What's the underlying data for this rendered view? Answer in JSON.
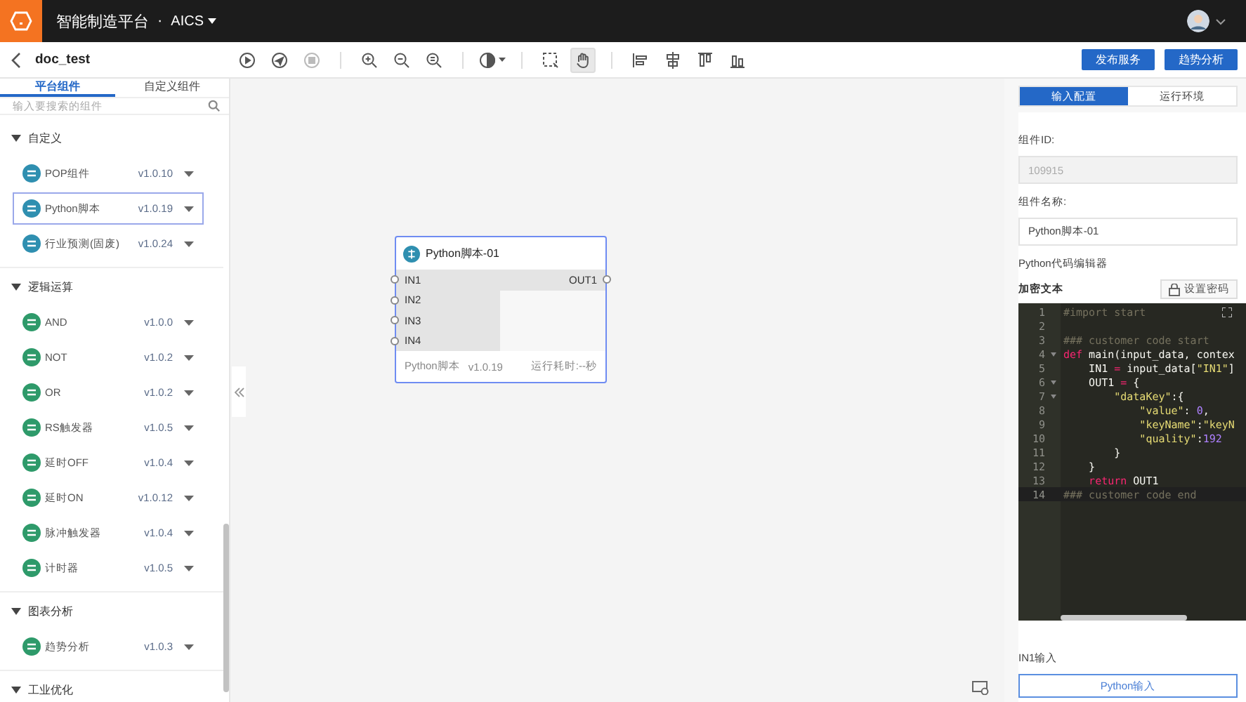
{
  "header": {
    "title": "智能制造平台",
    "separator": "·",
    "product": "AICS"
  },
  "toolbar": {
    "back_title": "doc_test",
    "tools": [
      {
        "kind": "play",
        "disabled": false,
        "selected": false
      },
      {
        "kind": "send",
        "disabled": false,
        "selected": false
      },
      {
        "kind": "stop",
        "disabled": true,
        "selected": false
      },
      {
        "kind": "zoom-in",
        "disabled": false,
        "selected": false
      },
      {
        "kind": "zoom-out",
        "disabled": false,
        "selected": false
      },
      {
        "kind": "zoom-fit",
        "disabled": false,
        "selected": false
      },
      {
        "kind": "theme",
        "disabled": false,
        "selected": false
      },
      {
        "kind": "select",
        "disabled": false,
        "selected": false
      },
      {
        "kind": "hand",
        "disabled": false,
        "selected": true
      },
      {
        "kind": "align-left",
        "disabled": false,
        "selected": false
      },
      {
        "kind": "align-center",
        "disabled": false,
        "selected": false
      },
      {
        "kind": "align-top",
        "disabled": false,
        "selected": false
      },
      {
        "kind": "align-bottom",
        "disabled": false,
        "selected": false
      }
    ],
    "buttons": [
      "发布服务",
      "趋势分析"
    ]
  },
  "sidebar": {
    "tabs": [
      {
        "label": "平台组件",
        "selected": true
      },
      {
        "label": "自定义组件",
        "selected": false
      }
    ],
    "search": {
      "placeholder": "输入要搜索的组件"
    },
    "sections": [
      {
        "title": "自定义",
        "expanded": true,
        "items": [
          {
            "name": "POP组件",
            "version": "v1.0.10",
            "color": "#2f8fb0",
            "selected": false
          },
          {
            "name": "Python脚本",
            "version": "v1.0.19",
            "color": "#2f8fb0",
            "selected": true
          },
          {
            "name": "行业预测(固废)",
            "version": "v1.0.24",
            "color": "#2f8fb0",
            "selected": false
          }
        ]
      },
      {
        "title": "逻辑运算",
        "expanded": true,
        "items": [
          {
            "name": "AND",
            "version": "v1.0.0",
            "color": "#2e9a6a",
            "selected": false
          },
          {
            "name": "NOT",
            "version": "v1.0.2",
            "color": "#2e9a6a",
            "selected": false
          },
          {
            "name": "OR",
            "version": "v1.0.2",
            "color": "#2e9a6a",
            "selected": false
          },
          {
            "name": "RS触发器",
            "version": "v1.0.5",
            "color": "#2e9a6a",
            "selected": false
          },
          {
            "name": "延时OFF",
            "version": "v1.0.4",
            "color": "#2e9a6a",
            "selected": false
          },
          {
            "name": "延时ON",
            "version": "v1.0.12",
            "color": "#2e9a6a",
            "selected": false
          },
          {
            "name": "脉冲触发器",
            "version": "v1.0.4",
            "color": "#2e9a6a",
            "selected": false
          },
          {
            "name": "计时器",
            "version": "v1.0.5",
            "color": "#2e9a6a",
            "selected": false
          }
        ]
      },
      {
        "title": "图表分析",
        "expanded": true,
        "items": [
          {
            "name": "趋势分析",
            "version": "v1.0.3",
            "color": "#2e9a6a",
            "selected": false
          }
        ]
      },
      {
        "title": "工业优化",
        "expanded": true
      }
    ]
  },
  "canvas": {
    "node": {
      "title": "Python脚本-01",
      "selected": true,
      "inputs": [
        "IN1",
        "IN2",
        "IN3",
        "IN4"
      ],
      "outputs": [
        "OUT1"
      ],
      "type": "Python脚本",
      "version": "v1.0.19",
      "runtime": "运行耗时:--秒"
    }
  },
  "panel": {
    "tabs": [
      {
        "label": "输入配置",
        "selected": true
      },
      {
        "label": "运行环境",
        "selected": false
      }
    ],
    "fields": [
      {
        "label": "组件ID:",
        "value": "109915",
        "disabled": true
      },
      {
        "label": "组件名称:",
        "value": "Python脚本-01",
        "disabled": false
      }
    ],
    "editor_label": "Python代码编辑器",
    "encrypt_label": "加密文本",
    "password_button": "设置密码",
    "code": [
      {
        "number": "1",
        "fold": false,
        "active": false,
        "tokens": [
          {
            "text": "#import start",
            "kind": "comment"
          }
        ]
      },
      {
        "number": "2",
        "fold": false,
        "active": false
      },
      {
        "number": "3",
        "fold": false,
        "active": false,
        "tokens": [
          {
            "text": "### customer code start",
            "kind": "comment"
          }
        ]
      },
      {
        "number": "4",
        "fold": true,
        "active": false,
        "tokens": [
          {
            "text": "def",
            "kind": "keyword"
          },
          {
            "text": " main(input_data, contex",
            "kind": "plain"
          }
        ]
      },
      {
        "number": "5",
        "fold": false,
        "active": false,
        "tokens": [
          {
            "text": "    IN1 ",
            "kind": "plain"
          },
          {
            "text": "=",
            "kind": "keyword"
          },
          {
            "text": " input_data[",
            "kind": "plain"
          },
          {
            "text": "\"IN1\"",
            "kind": "string"
          },
          {
            "text": "]",
            "kind": "plain"
          }
        ]
      },
      {
        "number": "6",
        "fold": true,
        "active": false,
        "tokens": [
          {
            "text": "    OUT1 ",
            "kind": "plain"
          },
          {
            "text": "=",
            "kind": "keyword"
          },
          {
            "text": " {",
            "kind": "plain"
          }
        ]
      },
      {
        "number": "7",
        "fold": true,
        "active": false,
        "tokens": [
          {
            "text": "        \"dataKey\"",
            "kind": "string"
          },
          {
            "text": ":{",
            "kind": "plain"
          }
        ]
      },
      {
        "number": "8",
        "fold": false,
        "active": false,
        "tokens": [
          {
            "text": "            \"value\"",
            "kind": "string"
          },
          {
            "text": ": ",
            "kind": "plain"
          },
          {
            "text": "0",
            "kind": "number"
          },
          {
            "text": ",",
            "kind": "plain"
          }
        ]
      },
      {
        "number": "9",
        "fold": false,
        "active": false,
        "tokens": [
          {
            "text": "            \"keyName\"",
            "kind": "string"
          },
          {
            "text": ":",
            "kind": "plain"
          },
          {
            "text": "\"keyN",
            "kind": "string"
          }
        ]
      },
      {
        "number": "10",
        "fold": false,
        "active": false,
        "tokens": [
          {
            "text": "            \"quality\"",
            "kind": "string"
          },
          {
            "text": ":",
            "kind": "plain"
          },
          {
            "text": "192",
            "kind": "number"
          }
        ]
      },
      {
        "number": "11",
        "fold": false,
        "active": false,
        "tokens": [
          {
            "text": "        }",
            "kind": "plain"
          }
        ]
      },
      {
        "number": "12",
        "fold": false,
        "active": false,
        "tokens": [
          {
            "text": "    }",
            "kind": "plain"
          }
        ]
      },
      {
        "number": "13",
        "fold": false,
        "active": false,
        "tokens": [
          {
            "text": "    return",
            "kind": "keyword"
          },
          {
            "text": " OUT1",
            "kind": "plain"
          }
        ]
      },
      {
        "number": "14",
        "fold": false,
        "active": true,
        "tokens": [
          {
            "text": "### customer code end",
            "kind": "comment"
          }
        ]
      }
    ],
    "input_label": "IN1输入",
    "input_value": "Python输入"
  }
}
